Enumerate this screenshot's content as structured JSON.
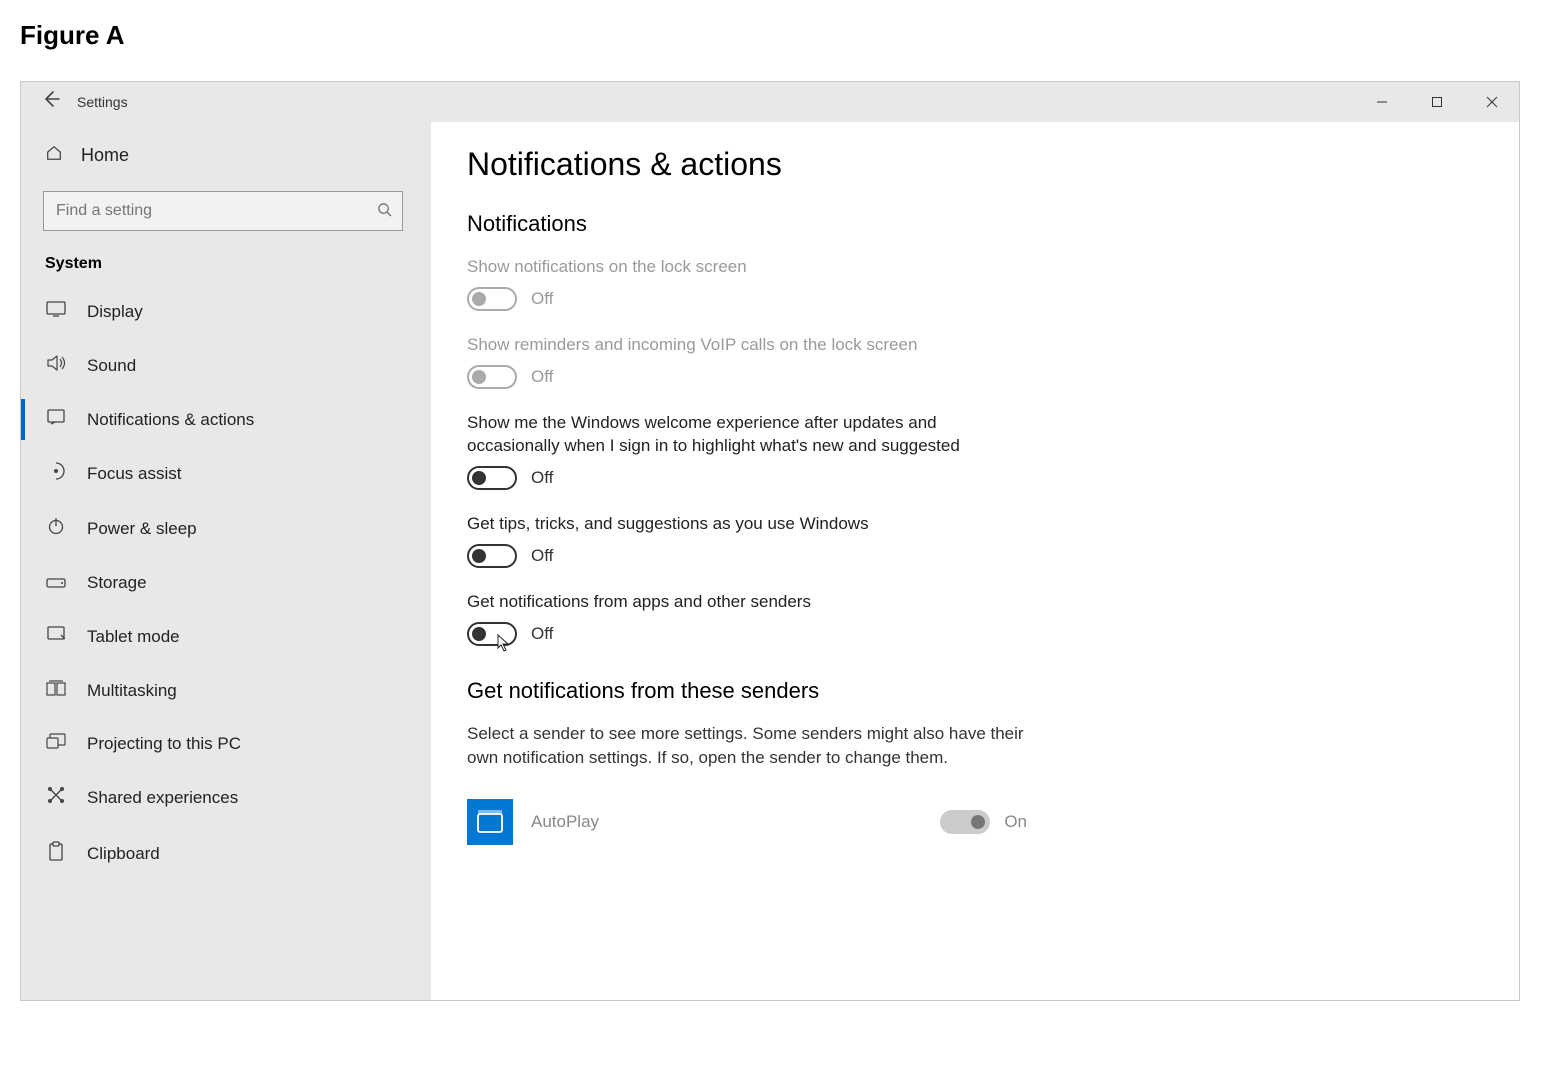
{
  "figure_label": "Figure A",
  "window": {
    "title": "Settings"
  },
  "sidebar": {
    "home_label": "Home",
    "search_placeholder": "Find a setting",
    "section": "System",
    "items": [
      {
        "label": "Display"
      },
      {
        "label": "Sound"
      },
      {
        "label": "Notifications & actions"
      },
      {
        "label": "Focus assist"
      },
      {
        "label": "Power & sleep"
      },
      {
        "label": "Storage"
      },
      {
        "label": "Tablet mode"
      },
      {
        "label": "Multitasking"
      },
      {
        "label": "Projecting to this PC"
      },
      {
        "label": "Shared experiences"
      },
      {
        "label": "Clipboard"
      }
    ]
  },
  "main": {
    "page_title": "Notifications & actions",
    "section_notifications": "Notifications",
    "toggles": [
      {
        "label": "Show notifications on the lock screen",
        "state": "Off",
        "disabled": true
      },
      {
        "label": "Show reminders and incoming VoIP calls on the lock screen",
        "state": "Off",
        "disabled": true
      },
      {
        "label": "Show me the Windows welcome experience after updates and occasionally when I sign in to highlight what's new and suggested",
        "state": "Off",
        "disabled": false
      },
      {
        "label": "Get tips, tricks, and suggestions as you use Windows",
        "state": "Off",
        "disabled": false
      },
      {
        "label": "Get notifications from apps and other senders",
        "state": "Off",
        "disabled": false
      }
    ],
    "section_senders": "Get notifications from these senders",
    "senders_desc": "Select a sender to see more settings. Some senders might also have their own notification settings. If so, open the sender to change them.",
    "senders": [
      {
        "name": "AutoPlay",
        "state": "On"
      }
    ]
  }
}
